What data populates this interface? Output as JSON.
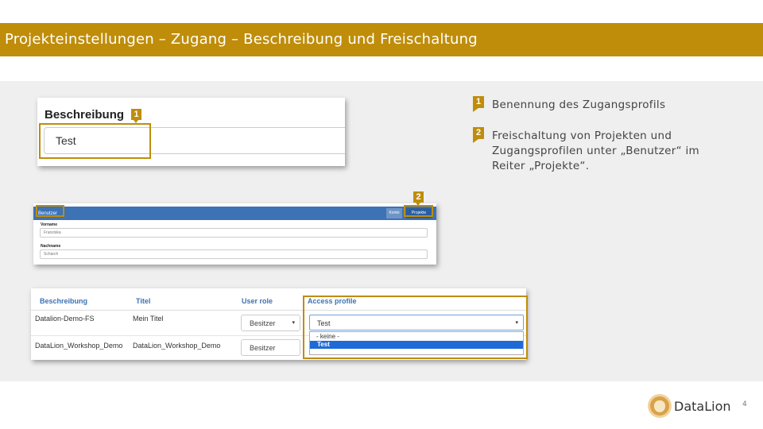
{
  "slide": {
    "title": "Projekteinstellungen – Zugang – Beschreibung und Freischaltung",
    "page_number": "4",
    "brand": "DataLion",
    "accent_color": "#bf8d0a"
  },
  "shot1": {
    "label": "Beschreibung",
    "input_value": "Test",
    "marker": "1"
  },
  "shot2": {
    "nav_title": "Benutzer",
    "nav_konto": "Konto",
    "nav_projekte": "Projekte",
    "marker": "2",
    "fields": [
      {
        "label": "Vorname",
        "value": "Franziska"
      },
      {
        "label": "Nachname",
        "value": "Scharch"
      }
    ]
  },
  "shot3": {
    "columns": [
      "Beschreibung",
      "Titel",
      "User role",
      "Access profile"
    ],
    "rows": [
      {
        "beschreibung": "Datalion-Demo-FS",
        "titel": "Mein Titel",
        "user_role": "Besitzer",
        "access_profile": "Test"
      },
      {
        "beschreibung": "DataLion_Workshop_Demo",
        "titel": "DataLion_Workshop_Demo",
        "user_role": "Besitzer"
      }
    ],
    "dropdown_options": [
      "- keine -",
      "Test"
    ],
    "dropdown_selected": "Test"
  },
  "notes": [
    {
      "marker": "1",
      "line1": "Benennung des Zugangsprofils"
    },
    {
      "marker": "2",
      "line1": "Freischaltung von Projekten und",
      "line2": "Zugangsprofilen unter „Benutzer“ im",
      "line3": "Reiter „Projekte“."
    }
  ]
}
